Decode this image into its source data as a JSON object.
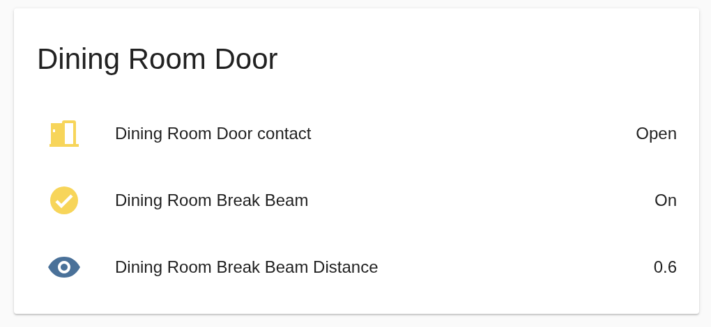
{
  "card": {
    "title": "Dining Room Door",
    "entities": [
      {
        "kind": "door",
        "color": "#f7d55a",
        "name": "Dining Room Door contact",
        "state": "Open"
      },
      {
        "kind": "check",
        "color": "#f7d55a",
        "name": "Dining Room Break Beam",
        "state": "On"
      },
      {
        "kind": "eye",
        "color": "#4a7199",
        "name": "Dining Room Break Beam Distance",
        "state": "0.6"
      }
    ]
  }
}
